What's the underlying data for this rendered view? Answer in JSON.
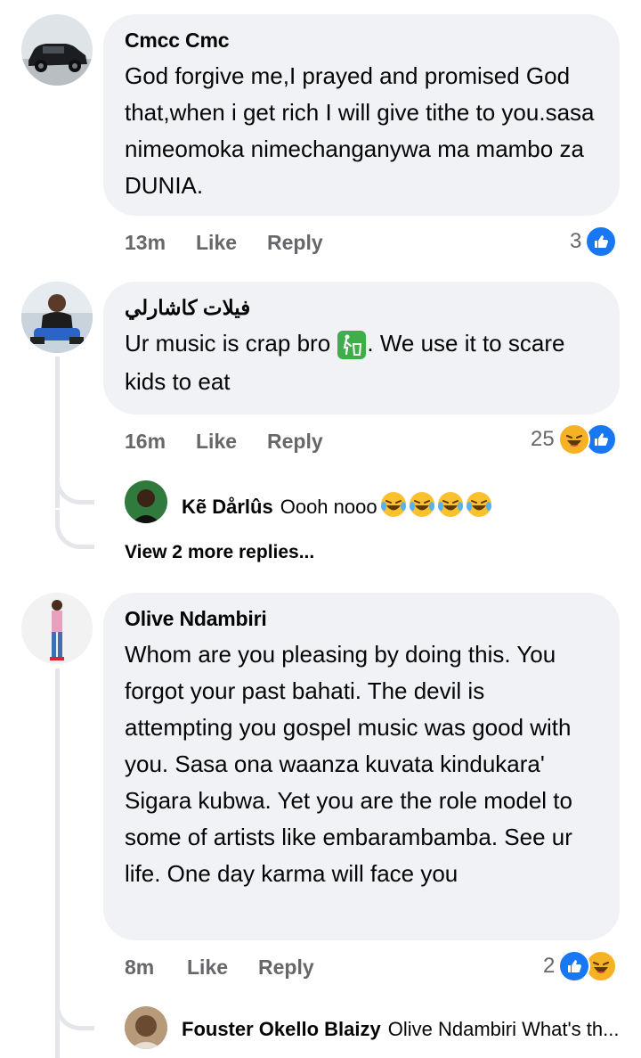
{
  "comments": [
    {
      "author": "Cmcc Cmc",
      "text": "God forgive me,I prayed  and promised God that,when i get rich I will give tithe to you.sasa nimeomoka nimechanganywa ma mambo za DUNIA.",
      "time": "13m",
      "like_label": "Like",
      "reply_label": "Reply",
      "reaction_count": "3",
      "reactions": [
        "like"
      ]
    },
    {
      "author": "فيلات كاشارلي",
      "text_before": "Ur music is crap bro",
      "text_after": ". We use it to scare kids to eat",
      "time": "16m",
      "like_label": "Like",
      "reply_label": "Reply",
      "reaction_count": "25",
      "reactions": [
        "haha",
        "like"
      ],
      "reply": {
        "author": "Kẽ Dårlûs",
        "text": "Oooh nooo"
      },
      "view_more": "View 2 more replies..."
    },
    {
      "author": "Olive Ndambiri",
      "text": "Whom are you pleasing by doing this. You forgot your past bahati. The devil is attempting you gospel music was good with you. Sasa ona  waanza kuvata kindukara' Sigara kubwa. Yet you are the role model to some of artists like embarambamba. See ur life. One day karma will face you",
      "time": "8m",
      "like_label": "Like",
      "reply_label": "Reply",
      "reaction_count": "2",
      "reactions": [
        "like",
        "haha"
      ],
      "reply": {
        "author": "Fouster Okello Blaizy",
        "text": "Olive Ndambiri What's th..."
      }
    }
  ],
  "colors": {
    "bubble": "#f0f2f5",
    "meta_text": "#65676b",
    "like_blue": "#1877f2",
    "haha_yellow": "#f7b125",
    "thread_line": "#e4e6eb"
  }
}
